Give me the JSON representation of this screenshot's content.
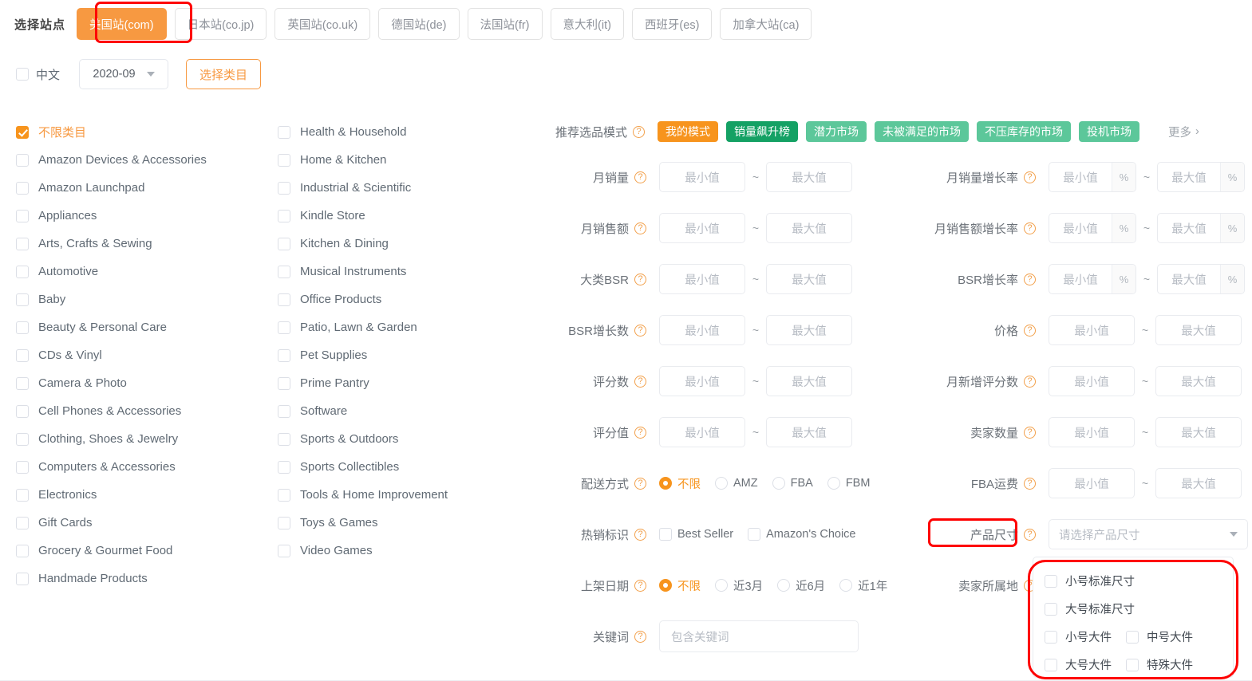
{
  "site_selector": {
    "label": "选择站点",
    "tabs": [
      {
        "label": "美国站(com)",
        "active": true
      },
      {
        "label": "日本站(co.jp)",
        "active": false
      },
      {
        "label": "英国站(co.uk)",
        "active": false
      },
      {
        "label": "德国站(de)",
        "active": false
      },
      {
        "label": "法国站(fr)",
        "active": false
      },
      {
        "label": "意大利(it)",
        "active": false
      },
      {
        "label": "西班牙(es)",
        "active": false
      },
      {
        "label": "加拿大站(ca)",
        "active": false
      }
    ]
  },
  "toolbar": {
    "chinese_label": "中文",
    "chinese_checked": false,
    "month_value": "2020-09",
    "pick_category_label": "选择类目"
  },
  "categories": {
    "col1": [
      {
        "label": "不限类目",
        "checked": true
      },
      {
        "label": "Amazon Devices & Accessories",
        "checked": false
      },
      {
        "label": "Amazon Launchpad",
        "checked": false
      },
      {
        "label": "Appliances",
        "checked": false
      },
      {
        "label": "Arts, Crafts & Sewing",
        "checked": false
      },
      {
        "label": "Automotive",
        "checked": false
      },
      {
        "label": "Baby",
        "checked": false
      },
      {
        "label": "Beauty & Personal Care",
        "checked": false
      },
      {
        "label": "CDs & Vinyl",
        "checked": false
      },
      {
        "label": "Camera & Photo",
        "checked": false
      },
      {
        "label": "Cell Phones & Accessories",
        "checked": false
      },
      {
        "label": "Clothing, Shoes & Jewelry",
        "checked": false
      },
      {
        "label": "Computers & Accessories",
        "checked": false
      },
      {
        "label": "Electronics",
        "checked": false
      },
      {
        "label": "Gift Cards",
        "checked": false
      },
      {
        "label": "Grocery & Gourmet Food",
        "checked": false
      },
      {
        "label": "Handmade Products",
        "checked": false
      }
    ],
    "col2": [
      {
        "label": "Health & Household",
        "checked": false
      },
      {
        "label": "Home & Kitchen",
        "checked": false
      },
      {
        "label": "Industrial & Scientific",
        "checked": false
      },
      {
        "label": "Kindle Store",
        "checked": false
      },
      {
        "label": "Kitchen & Dining",
        "checked": false
      },
      {
        "label": "Musical Instruments",
        "checked": false
      },
      {
        "label": "Office Products",
        "checked": false
      },
      {
        "label": "Patio, Lawn & Garden",
        "checked": false
      },
      {
        "label": "Pet Supplies",
        "checked": false
      },
      {
        "label": "Prime Pantry",
        "checked": false
      },
      {
        "label": "Software",
        "checked": false
      },
      {
        "label": "Sports & Outdoors",
        "checked": false
      },
      {
        "label": "Sports Collectibles",
        "checked": false
      },
      {
        "label": "Tools & Home Improvement",
        "checked": false
      },
      {
        "label": "Toys & Games",
        "checked": false
      },
      {
        "label": "Video Games",
        "checked": false
      }
    ]
  },
  "mode_row": {
    "label": "推荐选品模式",
    "tags": [
      {
        "label": "我的模式",
        "color": "#f7941d"
      },
      {
        "label": "销量飙升榜",
        "color": "#14a164"
      },
      {
        "label": "潜力市场",
        "color": "#5cc79a"
      },
      {
        "label": "未被满足的市场",
        "color": "#5cc79a"
      },
      {
        "label": "不压库存的市场",
        "color": "#5cc79a"
      },
      {
        "label": "投机市场",
        "color": "#5cc79a"
      }
    ],
    "more_label": "更多"
  },
  "placeholders": {
    "min": "最小值",
    "max": "最大值",
    "percent": "%",
    "tilde": "~"
  },
  "left_filters": [
    {
      "label": "月销量"
    },
    {
      "label": "月销售额"
    },
    {
      "label": "大类BSR"
    },
    {
      "label": "BSR增长数"
    },
    {
      "label": "评分数"
    },
    {
      "label": "评分值"
    }
  ],
  "right_filters": [
    {
      "label": "月销量增长率",
      "percent": true
    },
    {
      "label": "月销售额增长率",
      "percent": true
    },
    {
      "label": "BSR增长率",
      "percent": true
    },
    {
      "label": "价格",
      "percent": false
    },
    {
      "label": "月新增评分数",
      "percent": false
    },
    {
      "label": "卖家数量",
      "percent": false
    }
  ],
  "shipping": {
    "label": "配送方式",
    "options": [
      {
        "label": "不限",
        "selected": true
      },
      {
        "label": "AMZ",
        "selected": false
      },
      {
        "label": "FBA",
        "selected": false
      },
      {
        "label": "FBM",
        "selected": false
      }
    ]
  },
  "fba_fee": {
    "label": "FBA运费"
  },
  "hot_badge": {
    "label": "热销标识",
    "options": [
      {
        "label": "Best Seller",
        "checked": false
      },
      {
        "label": "Amazon's Choice",
        "checked": false
      }
    ]
  },
  "product_size": {
    "label": "产品尺寸",
    "select_placeholder": "请选择产品尺寸",
    "options": [
      {
        "label": "小号标准尺寸",
        "checked": false
      },
      {
        "label": "大号标准尺寸",
        "checked": false
      },
      {
        "label": "小号大件",
        "checked": false
      },
      {
        "label": "中号大件",
        "checked": false
      },
      {
        "label": "大号大件",
        "checked": false
      },
      {
        "label": "特殊大件",
        "checked": false
      }
    ]
  },
  "listing_date": {
    "label": "上架日期",
    "options": [
      {
        "label": "不限",
        "selected": true
      },
      {
        "label": "近3月",
        "selected": false
      },
      {
        "label": "近6月",
        "selected": false
      },
      {
        "label": "近1年",
        "selected": false
      }
    ]
  },
  "seller_location": {
    "label": "卖家所属地"
  },
  "keyword": {
    "label": "关键词",
    "placeholder": "包含关键词"
  },
  "highlight_color": "#fe0000"
}
